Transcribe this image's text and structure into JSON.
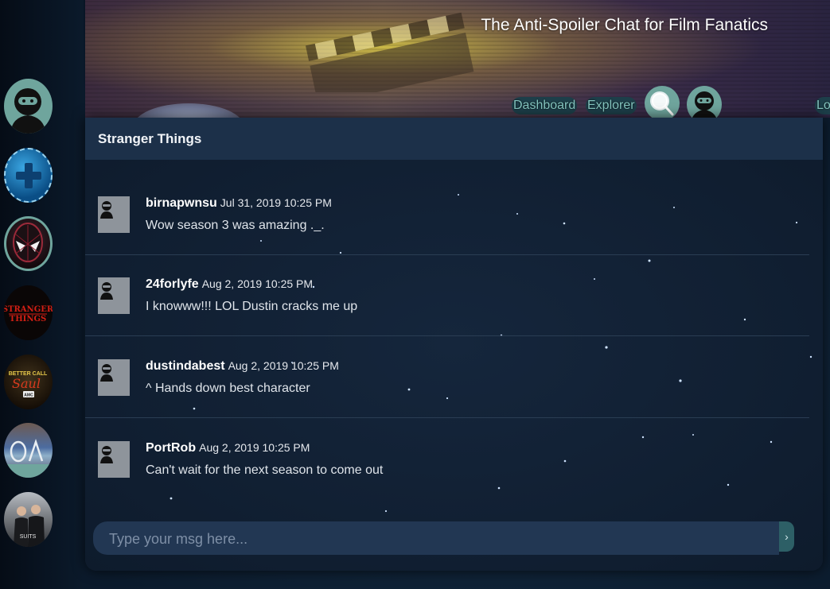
{
  "header": {
    "title": "The Anti-Spoiler Chat for Film Fanatics",
    "nav": {
      "dashboard": "Dashboard",
      "explorer": "Explorer",
      "logout": "Logout"
    }
  },
  "sidebar": {
    "items": [
      {
        "name": "profile",
        "icon": "ninja-avatar"
      },
      {
        "name": "add-room",
        "icon": "plus-icon"
      },
      {
        "name": "spider-man",
        "icon": "spider-mask-poster"
      },
      {
        "name": "stranger-things",
        "icon": "stranger-things-logo",
        "logo_text": "STRANGER THINGS"
      },
      {
        "name": "better-call-saul",
        "icon": "better-call-saul-logo",
        "logo_text": "BETTER CALL Saul AMC"
      },
      {
        "name": "the-oa",
        "icon": "the-oa-poster"
      },
      {
        "name": "suits",
        "icon": "suits-poster",
        "logo_text": "SUITS"
      }
    ]
  },
  "chat": {
    "room_title": "Stranger Things",
    "messages": [
      {
        "user": "birnapwnsu",
        "time": "Jul 31, 2019 10:25 PM",
        "text": "Wow season 3 was amazing ._."
      },
      {
        "user": "24forlyfe",
        "time": "Aug 2, 2019 10:25 PM",
        "text": "I knowww!!! LOL Dustin cracks me up"
      },
      {
        "user": "dustindabest",
        "time": "Aug 2, 2019 10:25 PM",
        "text": "^ Hands down best character"
      },
      {
        "user": "PortRob",
        "time": "Aug 2, 2019 10:25 PM",
        "text": "Can't wait for the next season to come out"
      }
    ],
    "composer": {
      "placeholder": "Type your msg here..."
    },
    "send_glyph": "›"
  },
  "colors": {
    "accent_teal": "#6fa59d",
    "nav_text": "#85c6c1",
    "panel_header": "#1c3049",
    "panel_body": "#0e1b2c"
  }
}
